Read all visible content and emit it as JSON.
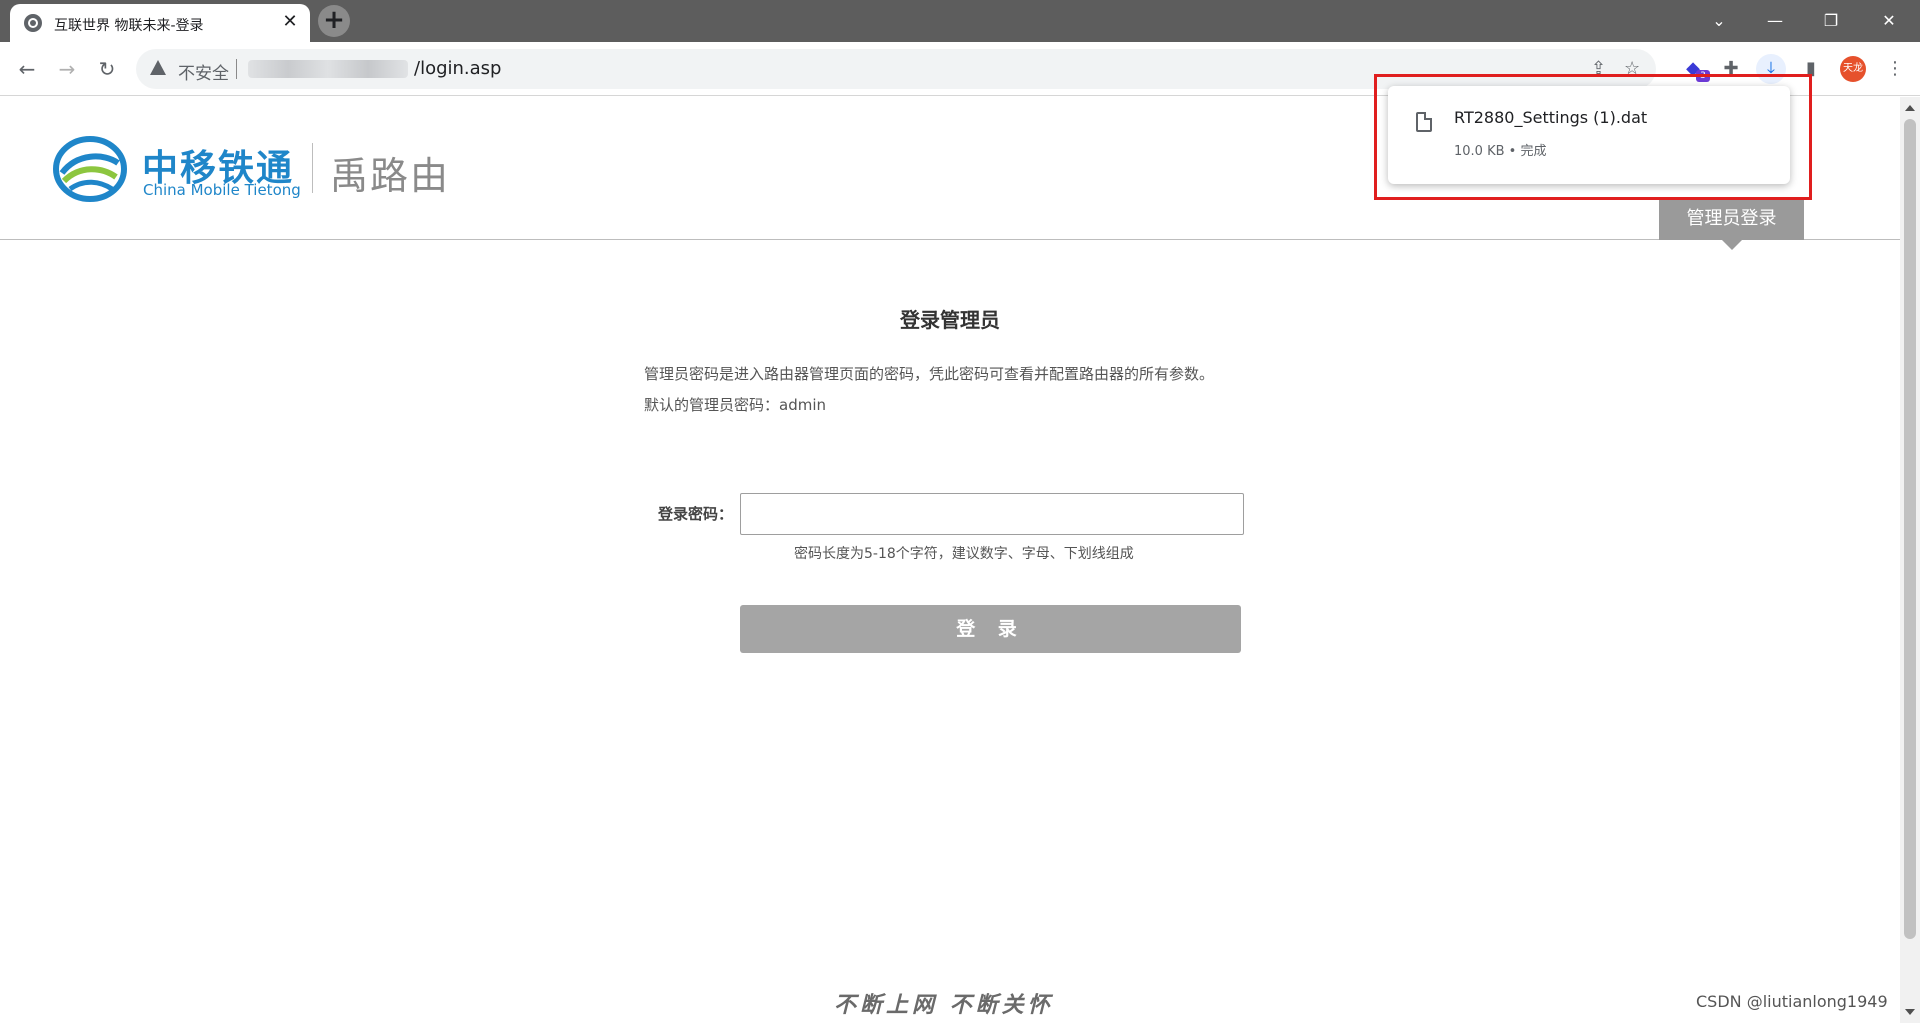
{
  "browser": {
    "tab_title": "互联世界 物联未来-登录",
    "tab_close": "✕",
    "new_tab": "+",
    "window_controls": {
      "tabs_menu": "⌄",
      "minimize": "—",
      "restore": "❐",
      "close": "✕"
    },
    "security_label": "不安全",
    "url_path": "/login.asp",
    "extension_badge": "3",
    "avatar_text": "天龙"
  },
  "header": {
    "logo_cn": "中移铁通",
    "logo_en": "China Mobile Tietong",
    "product": "禹路由",
    "admin_tab": "管理员登录"
  },
  "login": {
    "title": "登录管理员",
    "desc_line1": "管理员密码是进入路由器管理页面的密码，凭此密码可查看并配置路由器的所有参数。",
    "desc_line2": "默认的管理员密码：admin",
    "password_label": "登录密码：",
    "password_value": "",
    "password_hint": "密码长度为5-18个字符，建议数字、字母、下划线组成",
    "button_label": "登 录"
  },
  "footer": {
    "slogan": "不断上网  不断关怀",
    "watermark": "CSDN @liutianlong1949"
  },
  "download": {
    "file_name": "RT2880_Settings (1).dat",
    "status": "10.0 KB • 完成"
  },
  "colors": {
    "brand_blue": "#1f86c9",
    "brand_green": "#8cc63f",
    "button_gray": "#a5a5a5",
    "highlight_red": "#e01e1e"
  }
}
